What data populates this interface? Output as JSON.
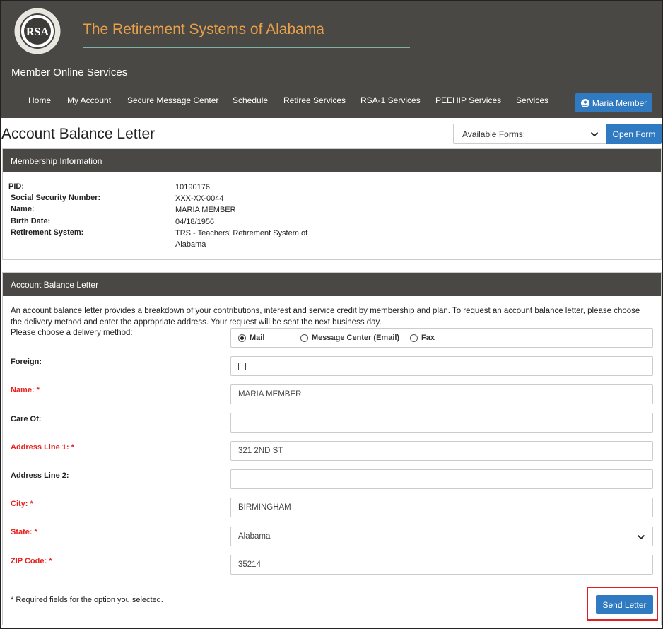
{
  "brand": {
    "logo_text": "RSA",
    "logo_ring_text": "THE RETIREMENT SYSTEMS OF ALABAMA",
    "title": "The Retirement Systems of Alabama",
    "subtitle": "Member Online Services"
  },
  "nav": {
    "items": [
      "Home",
      "My Account",
      "Secure Message Center",
      "Schedule",
      "Retiree Services",
      "RSA-1 Services",
      "PEEHIP Services",
      "Services"
    ],
    "user_label": "Maria Member"
  },
  "page": {
    "title": "Account Balance Letter",
    "forms_select": "Available Forms:",
    "open_form_label": "Open Form"
  },
  "membership": {
    "header": "Membership Information",
    "rows": [
      {
        "label": "PID:",
        "value": "10190176"
      },
      {
        "label": "Social Security Number:",
        "value": "XXX-XX-0044"
      },
      {
        "label": "Name:",
        "value": "MARIA MEMBER"
      },
      {
        "label": "Birth Date:",
        "value": "04/18/1956"
      },
      {
        "label": "Retirement System:",
        "value": "TRS - Teachers' Retirement System of Alabama"
      }
    ]
  },
  "letter": {
    "header": "Account Balance Letter",
    "description": "An account balance letter provides a breakdown of your contributions, interest and service credit by membership and plan. To request an account balance letter, please choose the delivery method and enter the appropriate address. Your request will be sent the next business day.",
    "delivery_prompt": "Please choose a delivery method:",
    "delivery_options": [
      "Mail",
      "Message Center (Email)",
      "Fax"
    ],
    "delivery_selected": "Mail",
    "foreign_label": "Foreign:",
    "foreign_checked": false,
    "fields": {
      "name": {
        "label": "Name: *",
        "value": "MARIA MEMBER"
      },
      "care_of": {
        "label": "Care Of:",
        "value": ""
      },
      "address1": {
        "label": "Address Line 1: *",
        "value": "321 2ND ST"
      },
      "address2": {
        "label": "Address Line 2:",
        "value": ""
      },
      "city": {
        "label": "City: *",
        "value": "BIRMINGHAM"
      },
      "state": {
        "label": "State: *",
        "value": "Alabama"
      },
      "zip": {
        "label": "ZIP Code: *",
        "value": "35214"
      }
    },
    "required_note": "* Required fields for the option you selected.",
    "send_label": "Send Letter"
  },
  "colors": {
    "header_bg": "#4a4844",
    "brand_title": "#e8a04a",
    "accent_blue": "#2f7ac1",
    "required_red": "#e8201e",
    "highlight_red": "#e02020"
  }
}
